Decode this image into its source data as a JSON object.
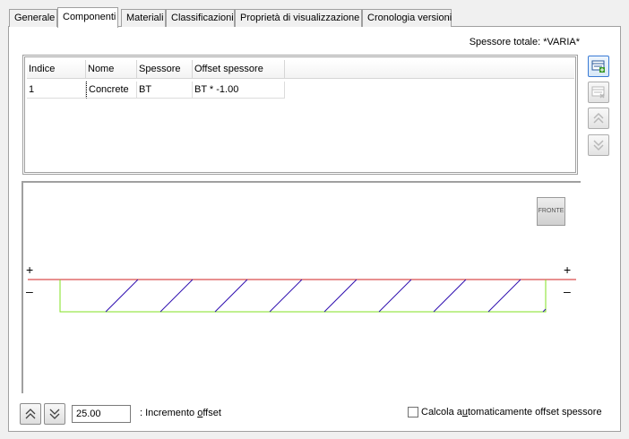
{
  "tabs": [
    "Generale",
    "Componenti",
    "Materiali",
    "Classificazioni",
    "Proprietà di visualizzazione",
    "Cronologia versioni"
  ],
  "active_tab": "Componenti",
  "total_thickness": "Spessore totale: *VARIA*",
  "grid": {
    "columns": [
      "Indice",
      "Nome",
      "Spessore",
      "Offset spessore"
    ],
    "rows": [
      [
        "1",
        "Concrete",
        "BT",
        "BT * -1.00"
      ]
    ]
  },
  "side_buttons": [
    "add-component-icon",
    "delete-component-icon",
    "move-up-icon",
    "move-down-icon"
  ],
  "preview": {
    "fronte_label": "FRONTE",
    "plus_sign": "+",
    "minus_sign": "–",
    "colors": {
      "reference_line": "#d02020",
      "outline": "#80e020",
      "hatch": "#3010b0"
    }
  },
  "bottom": {
    "offset_value": "25.00",
    "increment_label_prefix": ": Incremento ",
    "increment_label_accel": "o",
    "increment_label_suffix": "ffset",
    "auto_label_prefix": "Calcola a",
    "auto_label_accel": "u",
    "auto_label_suffix": "tomaticamente offset spessore",
    "auto_checked": false
  }
}
